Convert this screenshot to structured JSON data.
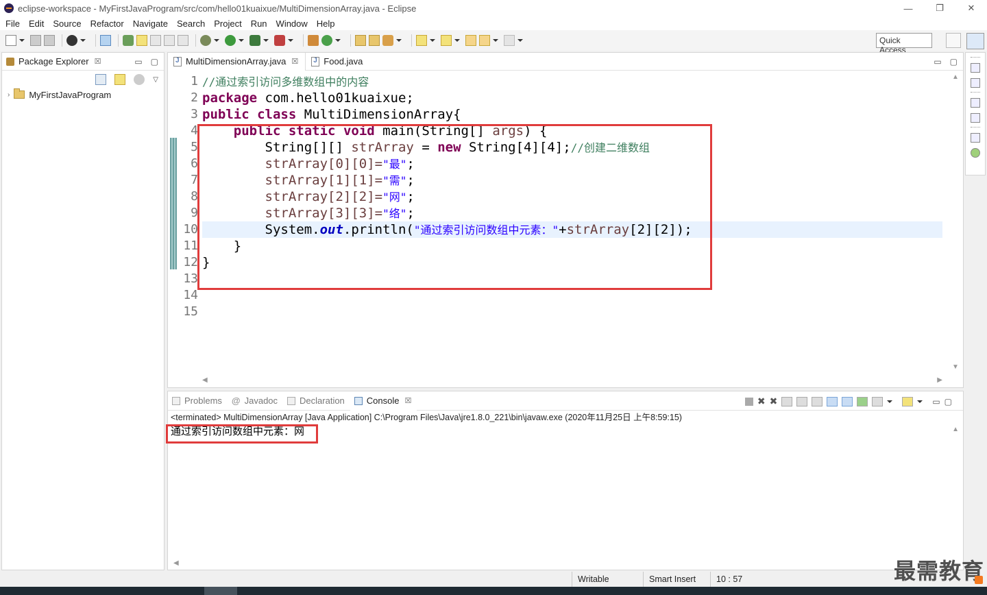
{
  "window": {
    "title": "eclipse-workspace - MyFirstJavaProgram/src/com/hello01kuaixue/MultiDimensionArray.java - Eclipse",
    "minimize": "—",
    "restore": "❐",
    "close": "✕"
  },
  "menu": [
    "File",
    "Edit",
    "Source",
    "Refactor",
    "Navigate",
    "Search",
    "Project",
    "Run",
    "Window",
    "Help"
  ],
  "toolbar": {
    "quick_access": "Quick Access"
  },
  "package_explorer": {
    "tab_label": "Package Explorer",
    "close": "☒",
    "project": "MyFirstJavaProgram"
  },
  "editor": {
    "tabs": [
      {
        "label": "MultiDimensionArray.java",
        "close": "☒"
      },
      {
        "label": "Food.java"
      }
    ],
    "line_numbers": [
      "1",
      "2",
      "3",
      "4",
      "5",
      "6",
      "7",
      "8",
      "9",
      "10",
      "11",
      "12",
      "13",
      "14",
      "15"
    ],
    "code": {
      "l1_comment": "//通过索引访问多维数组中的内容",
      "l2_kw": "package",
      "l2_rest": " com.hello01kuaixue;",
      "l3_kw1": "public",
      "l3_kw2": "class",
      "l3_rest": " MultiDimensionArray{",
      "l4_indent": "    ",
      "l4_kw1": "public",
      "l4_kw2": "static",
      "l4_kw3": "void",
      "l4_rest": " main(String[] ",
      "l4_var": "args",
      "l4_end": ") {",
      "l5_indent": "        ",
      "l5_type": "String[][] ",
      "l5_var": "strArray",
      "l5_eq": " = ",
      "l5_kw": "new",
      "l5_rest": " String[4][4];",
      "l5_comment": "//创建二维数组",
      "l6": "strArray[0][0]=",
      "l6_str": "\"最\"",
      "l7": "strArray[1][1]=",
      "l7_str": "\"需\"",
      "l8": "strArray[2][2]=",
      "l8_str": "\"网\"",
      "l9": "strArray[3][3]=",
      "l9_str": "\"络\"",
      "l10_pre": "System.",
      "l10_field": "out",
      "l10_mid": ".println(",
      "l10_str": "\"通过索引访问数组中元素：\"",
      "l10_plus": "+",
      "l10_var": "strArray",
      "l10_end": "[2][2]);",
      "l11": "    }",
      "l12": "}",
      "semicolon": ";"
    }
  },
  "console": {
    "tabs": [
      {
        "label": "Problems"
      },
      {
        "label": "Javadoc"
      },
      {
        "label": "Declaration"
      },
      {
        "label": "Console",
        "close": "☒"
      }
    ],
    "terminated": "<terminated> MultiDimensionArray [Java Application] C:\\Program Files\\Java\\jre1.8.0_221\\bin\\javaw.exe (2020年11月25日 上午8:59:15)",
    "output": "通过索引访问数组中元素：网"
  },
  "status": {
    "writable": "Writable",
    "insert_mode": "Smart Insert",
    "position": "10 : 57"
  },
  "watermark": "最需教育",
  "colors": {
    "keyword": "#7f0055",
    "comment": "#3f7f5f",
    "string": "#2a00ff",
    "highlight_border": "#e03c3c"
  }
}
